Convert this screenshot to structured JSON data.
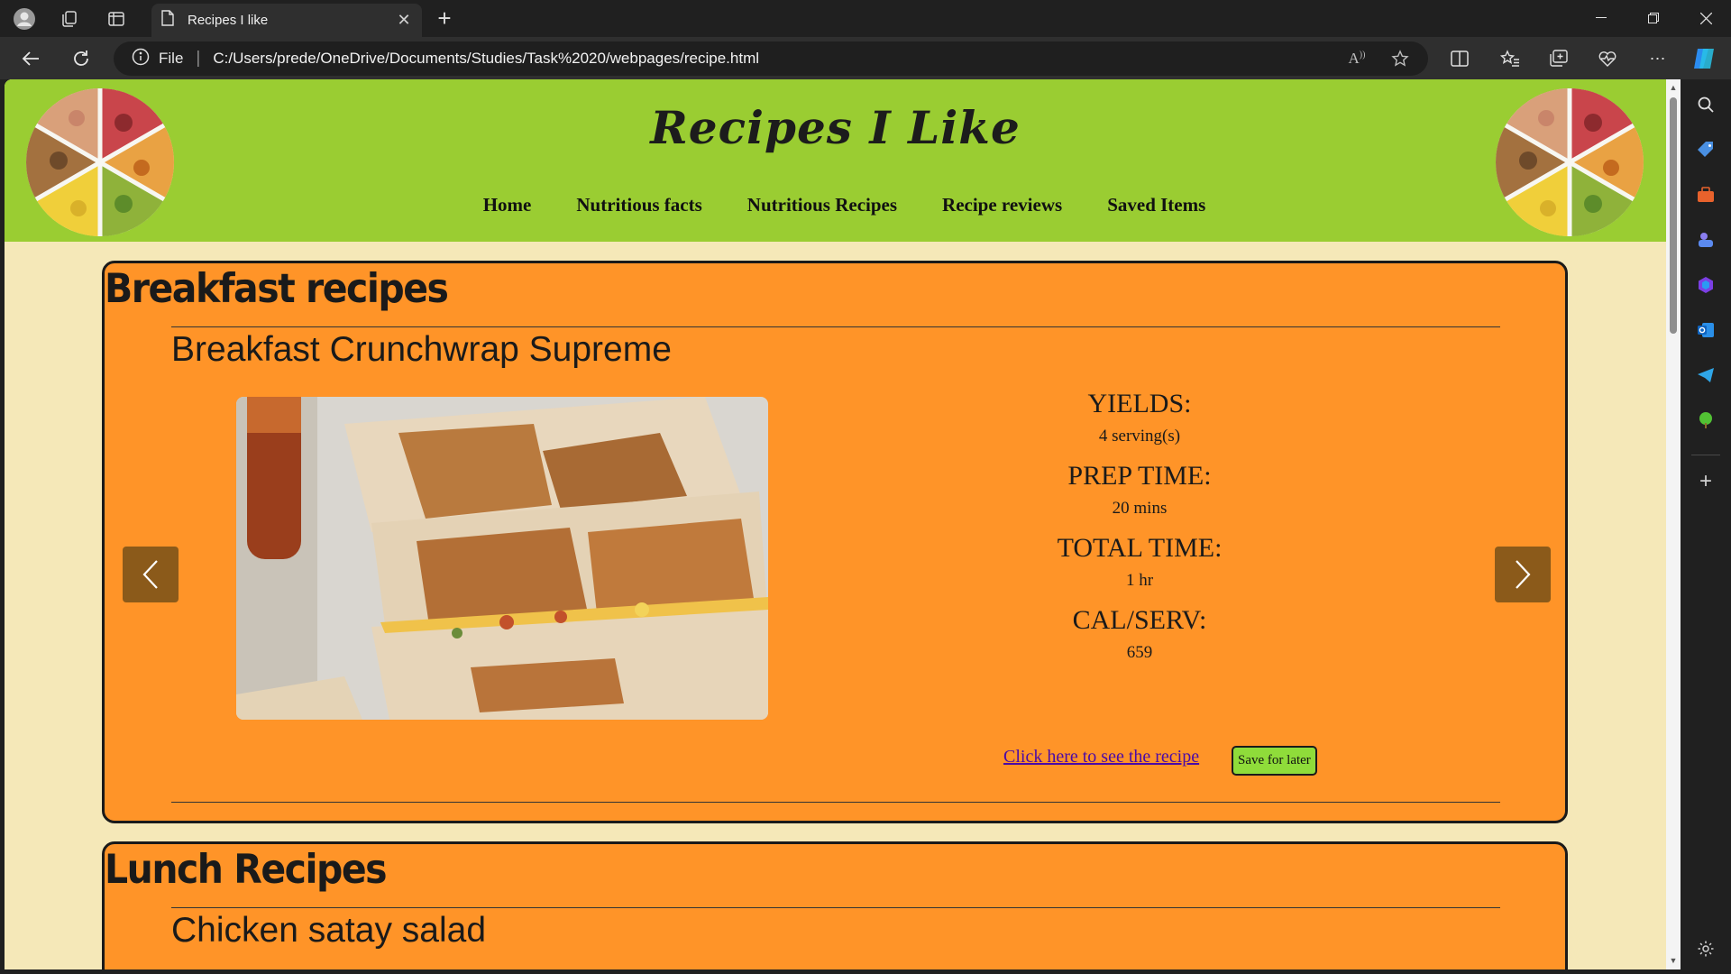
{
  "browser": {
    "tab_title": "Recipes I like",
    "address_protocol": "File",
    "address_url": "C:/Users/prede/OneDrive/Documents/Studies/Task%2020/webpages/recipe.html",
    "colors": {
      "chrome": "#202020",
      "toolbar": "#2f2f2f",
      "accent": "#3b82f6"
    }
  },
  "site": {
    "title": "Recipes I Like",
    "nav": [
      "Home",
      "Nutritious facts",
      "Nutritious Recipes",
      "Recipe reviews",
      "Saved Items"
    ],
    "colors": {
      "header": "#9acd32",
      "page": "#f5e8b8",
      "card": "#ff9428",
      "button": "#8b5a1a"
    }
  },
  "sections": [
    {
      "heading": "Breakfast recipes",
      "recipe": {
        "name": "Breakfast Crunchwrap Supreme",
        "stats": [
          {
            "label": "YIELDS:",
            "value": "4 serving(s)"
          },
          {
            "label": "PREP TIME:",
            "value": "20 mins"
          },
          {
            "label": "TOTAL TIME:",
            "value": "1 hr"
          },
          {
            "label": "CAL/SERV:",
            "value": "659"
          }
        ],
        "link_text": "Click here to see the recipe",
        "save_label": "Save for later"
      }
    },
    {
      "heading": "Lunch Recipes",
      "recipe": {
        "name": "Chicken satay salad"
      }
    }
  ],
  "icons": {
    "prev": "chevron-left-icon",
    "next": "chevron-right-icon",
    "info": "info-icon",
    "back": "back-arrow-icon",
    "refresh": "refresh-icon"
  }
}
